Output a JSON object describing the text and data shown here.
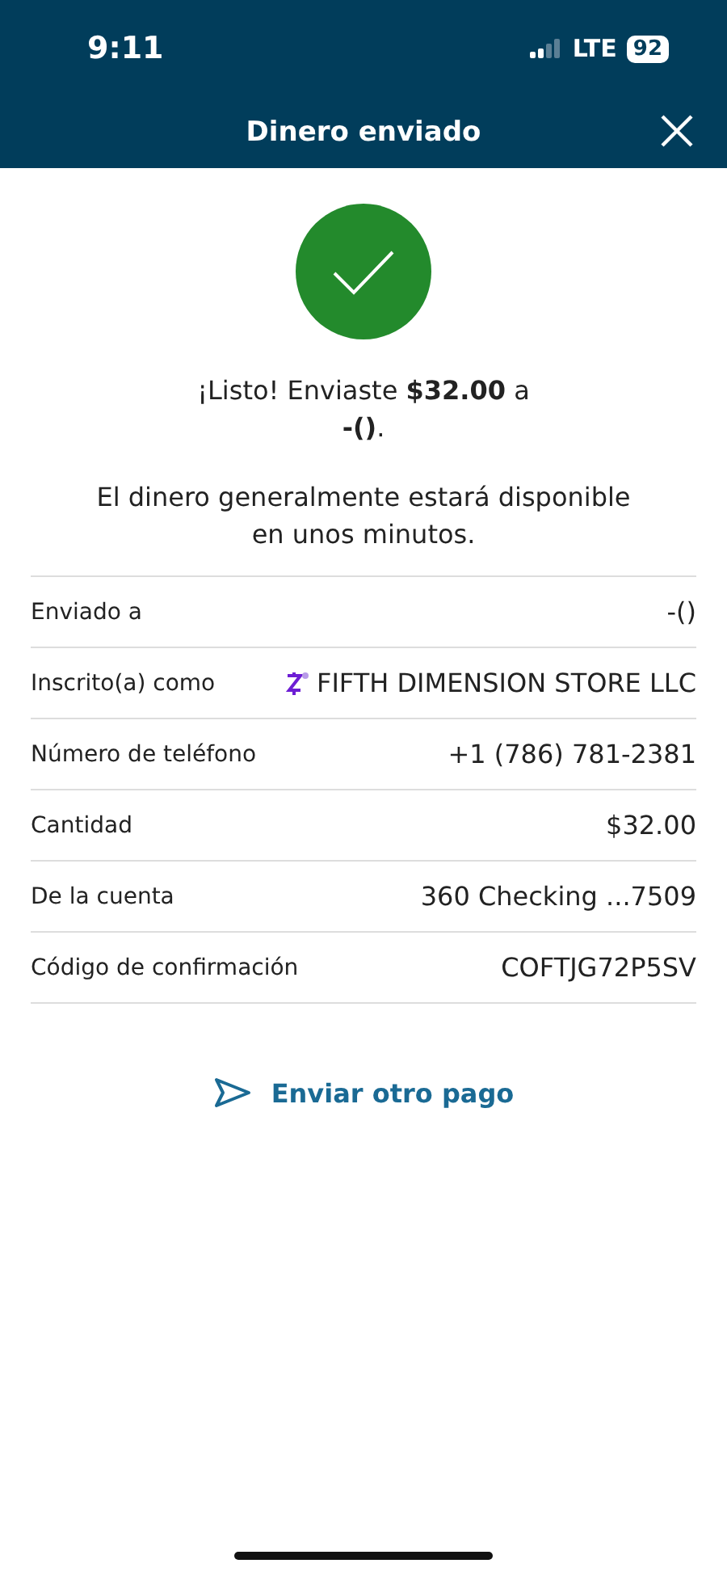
{
  "status_bar": {
    "time": "9:11",
    "network": "LTE",
    "battery": "92"
  },
  "header": {
    "title": "Dinero enviado"
  },
  "confirmation": {
    "message": "¡Listo! Enviaste **$32.00** a **-()**.",
    "note": "El dinero generalmente estará disponible en unos minutos."
  },
  "details": [
    {
      "label": "Enviado a",
      "value": "-()",
      "kind": "plain"
    },
    {
      "label": "Inscrito(a) como",
      "value": "FIFTH DIMENSION STORE LLC",
      "kind": "zelle"
    },
    {
      "label": "Número de teléfono",
      "value": "+1 (786) 781-2381",
      "kind": "plain"
    },
    {
      "label": "Cantidad",
      "value": "$32.00",
      "kind": "plain"
    },
    {
      "label": "De la cuenta",
      "value": "360 Checking ...7509",
      "kind": "plain"
    },
    {
      "label": "Código de confirmación",
      "value": "COFTJG72P5SV",
      "kind": "plain"
    }
  ],
  "action": {
    "label": "Enviar otro pago"
  }
}
